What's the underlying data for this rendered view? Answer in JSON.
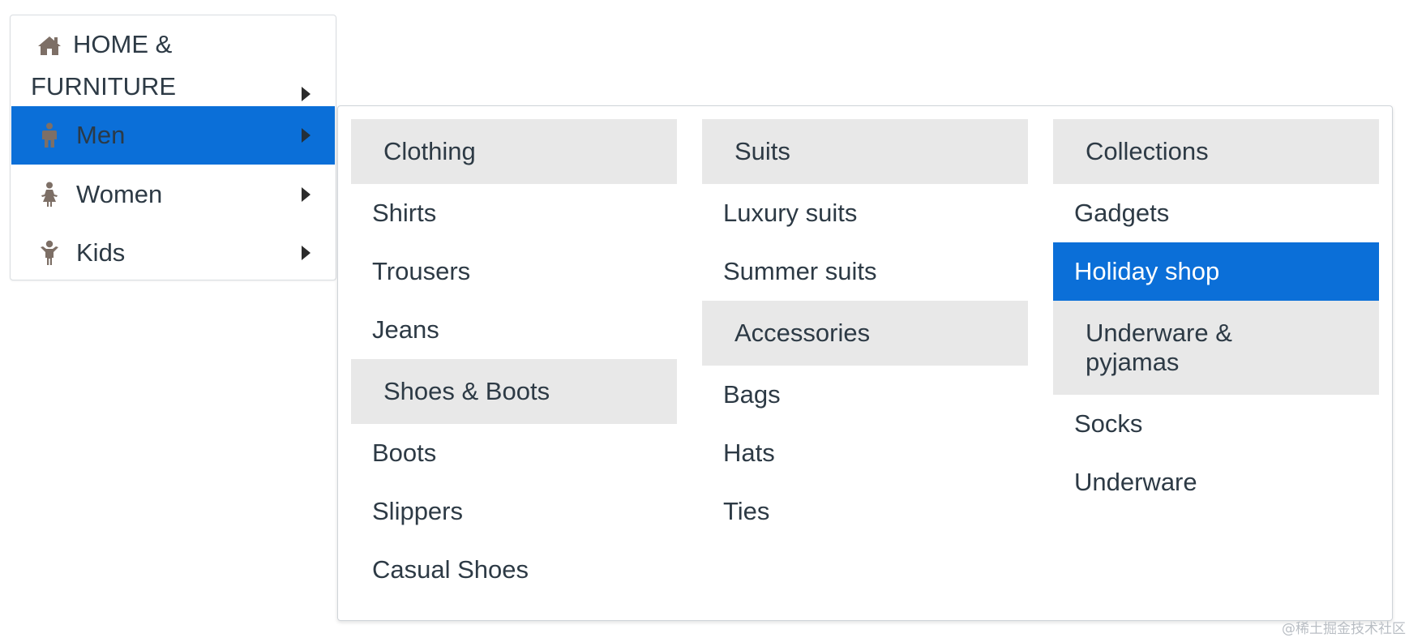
{
  "side_menu": {
    "items": [
      {
        "label_line1": "HOME &",
        "label_line2": "FURNITURE",
        "icon": "home-icon"
      },
      {
        "label": "Men",
        "icon": "man-icon",
        "active": true
      },
      {
        "label": "Women",
        "icon": "woman-icon"
      },
      {
        "label": "Kids",
        "icon": "child-icon"
      }
    ]
  },
  "mega_menu": {
    "columns": [
      {
        "groups": [
          {
            "heading": "Clothing",
            "links": [
              "Shirts",
              "Trousers",
              "Jeans"
            ]
          },
          {
            "heading": "Shoes & Boots",
            "links": [
              "Boots",
              "Slippers",
              "Casual Shoes"
            ]
          }
        ]
      },
      {
        "groups": [
          {
            "heading": "Suits",
            "links": [
              "Luxury suits",
              "Summer suits"
            ]
          },
          {
            "heading": "Accessories",
            "links": [
              "Bags",
              "Hats",
              "Ties"
            ]
          }
        ]
      },
      {
        "groups": [
          {
            "heading": "Collections",
            "links": [
              "Gadgets",
              "Holiday shop"
            ]
          },
          {
            "heading": "Underware & pyjamas",
            "links": [
              "Socks",
              "Underware"
            ]
          }
        ]
      }
    ],
    "active_link": "Holiday shop"
  },
  "colors": {
    "accent": "#0b6fd8",
    "header_bg": "#e8e8e8",
    "text": "#2d3a45",
    "icon": "#7d6f66"
  },
  "watermark": "@稀土掘金技术社区"
}
